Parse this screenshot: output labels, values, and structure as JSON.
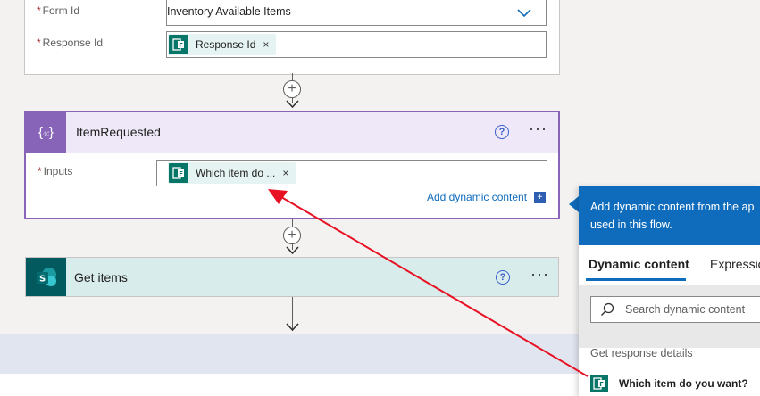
{
  "form_card": {
    "form_id": {
      "label": "Form Id",
      "value": "Inventory Available Items"
    },
    "response_id": {
      "label": "Response Id",
      "token": "Response Id"
    }
  },
  "connector": {
    "add_symbol": "+"
  },
  "item_requested": {
    "title": "ItemRequested",
    "icon_glyph": "{𝓍}",
    "inputs_label": "Inputs",
    "token": "Which item do ...",
    "add_dynamic_content": "Add dynamic content",
    "add_dynamic_box": "+",
    "help": "?",
    "more": "···"
  },
  "get_items": {
    "title": "Get items",
    "help": "?",
    "more": "···"
  },
  "required_mark": "*",
  "token_remove": "×",
  "dynamic_panel": {
    "header_line1": "Add dynamic content from the ap",
    "header_line2": "used in this flow.",
    "tabs": [
      "Dynamic content",
      "Expressio"
    ],
    "search_placeholder": "Search dynamic content",
    "section": "Get response details",
    "item": "Which item do you want?"
  },
  "colors": {
    "accent_purple": "#8764b8",
    "forms_green": "#077568",
    "sharepoint_teal": "#035a5e",
    "link_blue": "#0f6cbd",
    "annotation_red": "#e81123"
  }
}
